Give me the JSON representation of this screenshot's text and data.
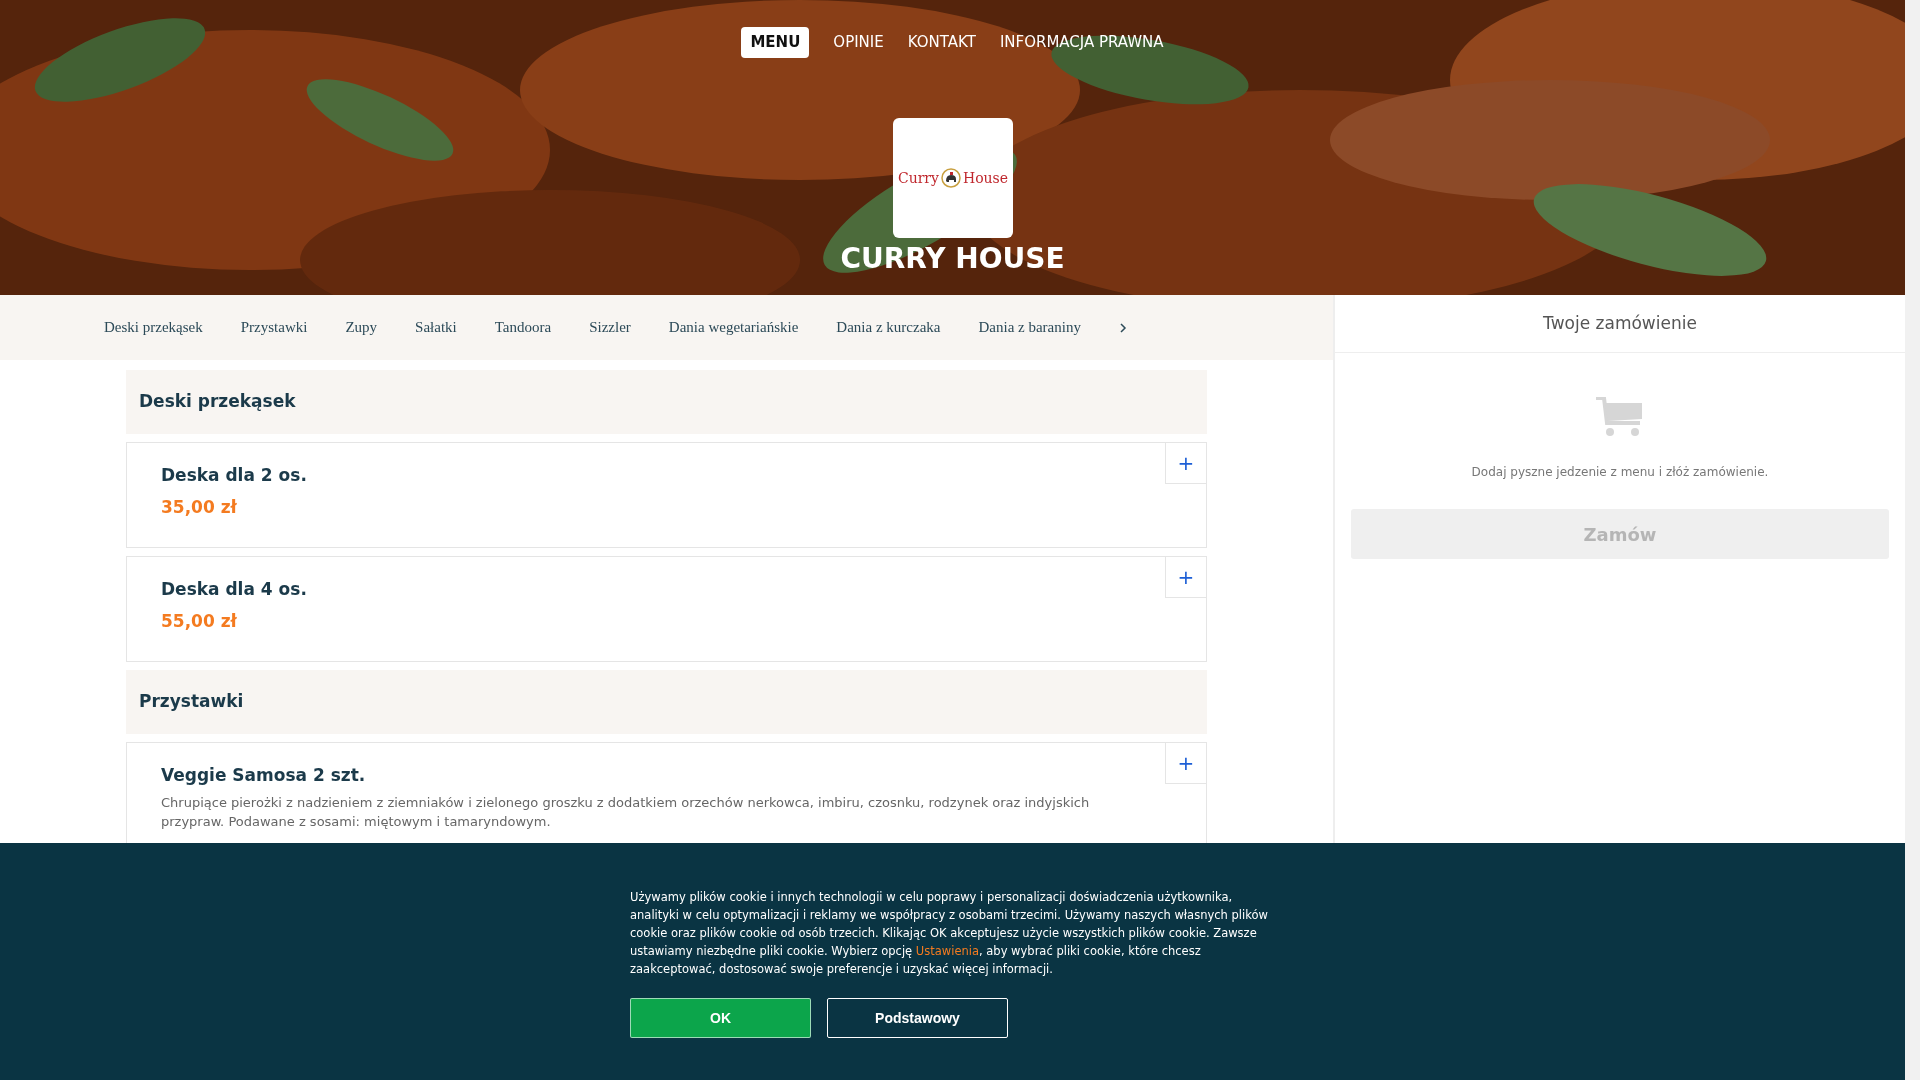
{
  "nav": [
    {
      "label": "MENU",
      "selected": true
    },
    {
      "label": "OPINIE",
      "selected": false
    },
    {
      "label": "KONTAKT",
      "selected": false
    },
    {
      "label": "INFORMACJA PRAWNA",
      "selected": false
    }
  ],
  "hero": {
    "kind": "picture",
    "restaurant_name": "CURRY HOUSE",
    "logo": {
      "left": "Curry",
      "right": "House"
    }
  },
  "categories": [
    {
      "label": "Deski przekąsek"
    },
    {
      "label": "Przystawki"
    },
    {
      "label": "Zupy"
    },
    {
      "label": "Sałatki"
    },
    {
      "label": "Tandoora"
    },
    {
      "label": "Sizzler"
    },
    {
      "label": "Dania wegetariańskie"
    },
    {
      "label": "Dania z kurczaka"
    },
    {
      "label": "Dania z baraniny"
    }
  ],
  "sections": [
    {
      "title": "Deski przekąsek",
      "items": [
        {
          "name": "Deska dla 2 os.",
          "price": "35,00 zł",
          "add": "+"
        },
        {
          "name": "Deska dla 4 os.",
          "price": "55,00 zł",
          "add": "+"
        }
      ]
    },
    {
      "title": "Przystawki",
      "items": [
        {
          "name": "Veggie Samosa 2 szt.",
          "description": "Chrupiące pierożki z nadzieniem z ziemniaków i zielonego groszku z dodatkiem orzechów nerkowca, imbiru, czosnku, rodzynek oraz indyjskich przypraw. Podawane z sosami: miętowym i tamaryndowym.",
          "add": "+"
        }
      ]
    }
  ],
  "cart": {
    "title": "Twoje zamówienie",
    "empty_text": "Dodaj pyszne jedzenie z menu i złóż zamówienie.",
    "order_button": {
      "label": "Zamów",
      "disabled": true
    }
  },
  "cookie_banner": {
    "text": "Używamy plików cookie i innych technologii w celu poprawy i personalizacji doświadczenia użytkownika, analityki w celu optymalizacji i reklamy we współpracy z osobami trzecimi. Używamy naszych własnych plików cookie oraz plików cookie od osób trzecich. Klikając OK akceptujesz użycie wszystkich plików cookie. Zawsze ustawiamy niezbędne pliki cookie. Wybierz opcję ",
    "link": "Ustawienia",
    "text_after": ", aby wybrać pliki cookie, które chcesz zaakceptować, dostosować swoje preferencje i uzyskać więcej informacji.",
    "buttons": [
      {
        "label": "OK",
        "kind": "primary"
      },
      {
        "label": "Podstawowy",
        "kind": "secondary"
      }
    ]
  }
}
